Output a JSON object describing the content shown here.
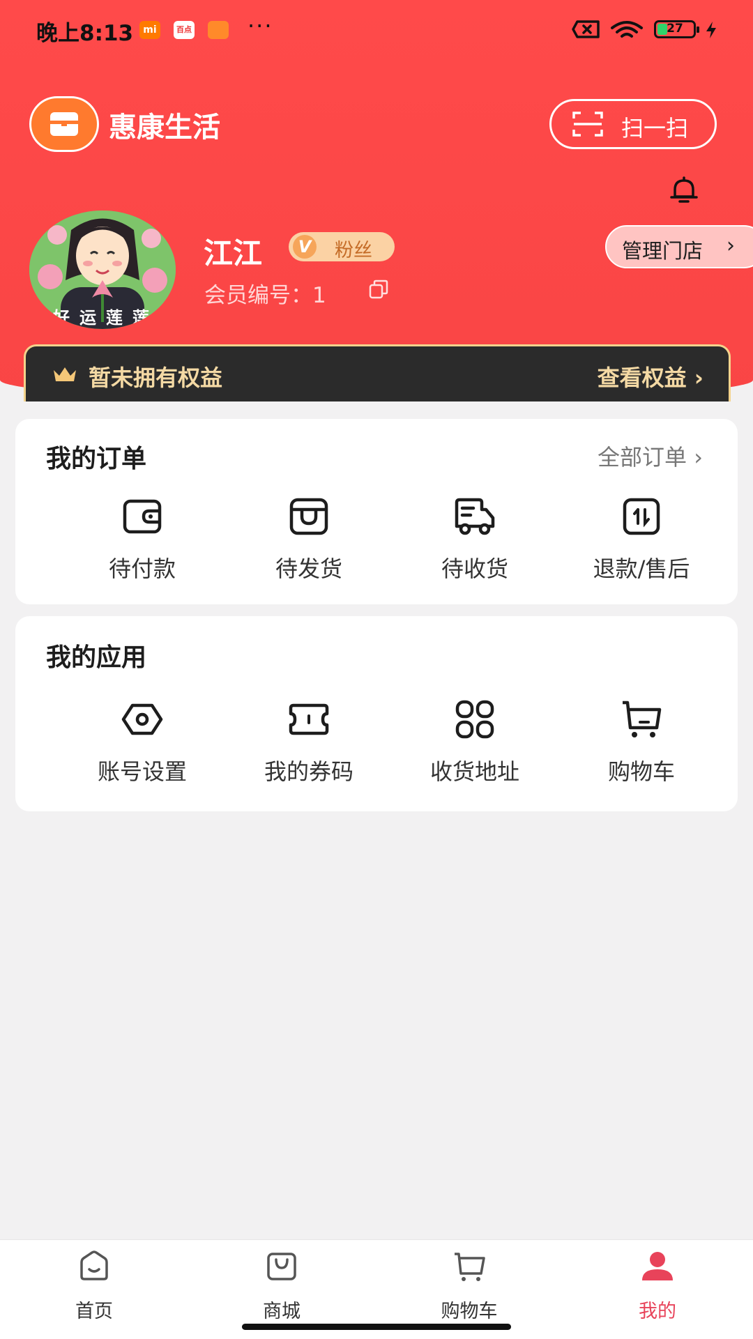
{
  "status_bar": {
    "time": "晚上8:13",
    "app_badges": [
      "mi",
      "百点",
      ""
    ],
    "more": "···",
    "battery": "27"
  },
  "header": {
    "app_title": "惠康生活",
    "scan_label": "扫一扫",
    "user_name": "江江",
    "fan_badge": "粉丝",
    "fan_badge_letter": "V",
    "member_no": "会员编号：1",
    "manage_store": "管理门店",
    "avatar_caption": "好运莲莲"
  },
  "benefit": {
    "text": "暂未拥有权益",
    "link": "查看权益 ›"
  },
  "orders": {
    "title": "我的订单",
    "link": "全部订单 ›",
    "items": [
      {
        "label": "待付款",
        "icon": "wallet-icon"
      },
      {
        "label": "待发货",
        "icon": "package-icon"
      },
      {
        "label": "待收货",
        "icon": "truck-icon"
      },
      {
        "label": "退款/售后",
        "icon": "refund-icon"
      }
    ]
  },
  "apps": {
    "title": "我的应用",
    "items": [
      {
        "label": "账号设置",
        "icon": "settings-icon"
      },
      {
        "label": "我的券码",
        "icon": "coupon-icon"
      },
      {
        "label": "收货地址",
        "icon": "grid-icon"
      },
      {
        "label": "购物车",
        "icon": "cart-icon"
      }
    ]
  },
  "tabbar": {
    "items": [
      {
        "label": "首页",
        "icon": "home-icon",
        "active": false
      },
      {
        "label": "商城",
        "icon": "bag-icon",
        "active": false
      },
      {
        "label": "购物车",
        "icon": "cart-icon",
        "active": false
      },
      {
        "label": "我的",
        "icon": "profile-icon",
        "active": true
      }
    ]
  },
  "colors": {
    "header_red": "#ff4a4a",
    "active_tab": "#e8435a",
    "benefit_gold": "#f4d9a4",
    "benefit_bg": "#2b2b2b"
  }
}
